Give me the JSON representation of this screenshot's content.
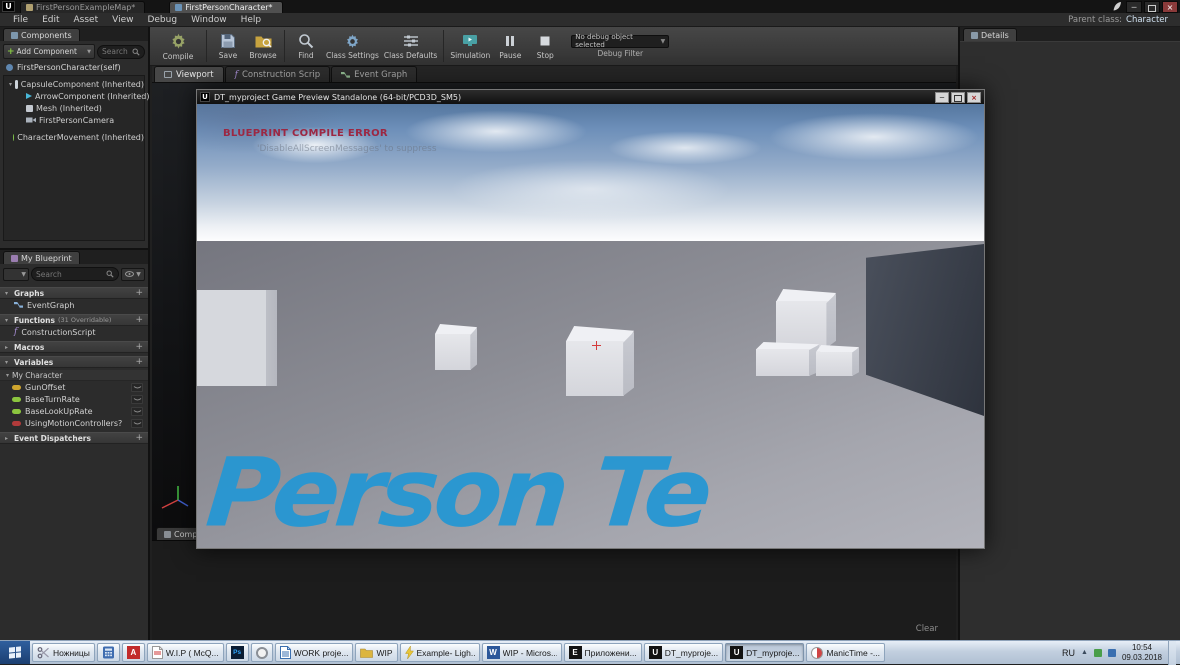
{
  "glyphs": {
    "plus": "+",
    "caret_down": "▾",
    "caret_right": "▸",
    "dropdown": "▼",
    "minimize": "─",
    "close": "×",
    "letter_u": "U",
    "letter_ps": "Ps",
    "letter_w": "W",
    "letter_e": "E",
    "letter_a": "A",
    "letter_f": "f",
    "up_arrow": "▲"
  },
  "title_bar": {
    "tabs": [
      {
        "label": "FirstPersonExampleMap*"
      },
      {
        "label": "FirstPersonCharacter*"
      }
    ]
  },
  "menu_bar": {
    "items": [
      "File",
      "Edit",
      "Asset",
      "View",
      "Debug",
      "Window",
      "Help"
    ],
    "parent_class_label": "Parent class:",
    "parent_class_value": "Character"
  },
  "toolbar": {
    "buttons": [
      "Compile",
      "Save",
      "Browse",
      "Find",
      "Class Settings",
      "Class Defaults",
      "Simulation",
      "Pause",
      "Stop"
    ],
    "debug_dropdown": "No debug object selected",
    "debug_filter": "Debug Filter"
  },
  "components_panel": {
    "tab": "Components",
    "add_component": "Add Component",
    "search_placeholder": "Search",
    "items": [
      "FirstPersonCharacter(self)",
      "CapsuleComponent (Inherited)",
      "ArrowComponent (Inherited)",
      "Mesh (Inherited)",
      "FirstPersonCamera",
      "CharacterMovement (Inherited)"
    ]
  },
  "my_blueprint": {
    "tab": "My Blueprint",
    "search_placeholder": "Search",
    "graphs_header": "Graphs",
    "event_graph_item": "EventGraph",
    "functions_header": "Functions",
    "functions_note": "(31 Overridable)",
    "construction_script_item": "ConstructionScript",
    "macros_header": "Macros",
    "variables_header": "Variables",
    "category": "My Character",
    "variables": [
      "GunOffset",
      "BaseTurnRate",
      "BaseLookUpRate",
      "UsingMotionControllers?"
    ],
    "event_dispatchers_header": "Event Dispatchers"
  },
  "main_tabs": {
    "viewport": "Viewport",
    "construction_script": "Construction Scrip",
    "event_graph": "Event Graph"
  },
  "compiler_results": {
    "tab": "Compil",
    "clear": "Clear"
  },
  "details_panel": {
    "tab": "Details"
  },
  "preview_window": {
    "title": "DT_myproject Game Preview Standalone (64-bit/PCD3D_SM5)",
    "error_text": "BLUEPRINT COMPILE ERROR",
    "suppress_text": "'DisableAllScreenMessages' to suppress",
    "floor_text": "Person Te"
  },
  "taskbar": {
    "items": [
      {
        "label": "Ножницы"
      },
      {
        "label": ""
      },
      {
        "label": ""
      },
      {
        "label": "W.I.P ( McQ..."
      },
      {
        "label": ""
      },
      {
        "label": ""
      },
      {
        "label": "WORK proje..."
      },
      {
        "label": "WIP"
      },
      {
        "label": "Example- Ligh..."
      },
      {
        "label": "WIP - Micros..."
      },
      {
        "label": "Приложени..."
      },
      {
        "label": "DT_myproje..."
      },
      {
        "label": "DT_myproje..."
      },
      {
        "label": "ManicTime -..."
      }
    ],
    "tray": {
      "language": "RU",
      "time": "10:54",
      "date": "09.03.2018"
    }
  }
}
